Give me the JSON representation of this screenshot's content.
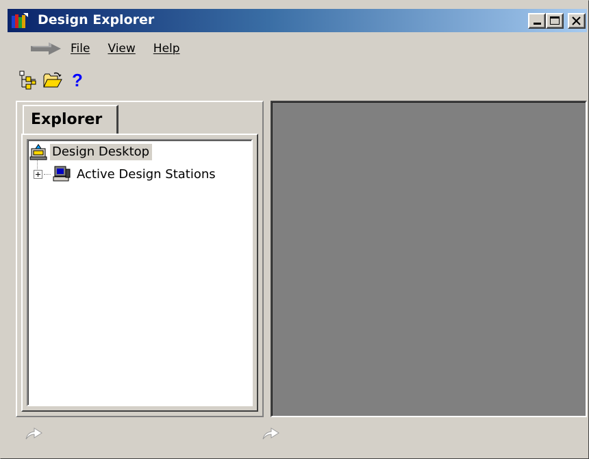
{
  "window": {
    "title": "Design Explorer",
    "icon": "design-explorer-app-icon",
    "title_gradient": [
      "#0a246a",
      "#a6caf0"
    ]
  },
  "caption_buttons": {
    "minimize": "minimize-icon",
    "maximize": "maximize-icon",
    "close": "close-icon"
  },
  "menu": {
    "back_icon": "back-arrow-icon",
    "items": [
      {
        "label": "File",
        "accel": "F"
      },
      {
        "label": "View",
        "accel": "V"
      },
      {
        "label": "Help",
        "accel": "H"
      }
    ]
  },
  "toolbar": {
    "buttons": [
      {
        "icon": "tree-view-icon"
      },
      {
        "icon": "open-folder-icon"
      },
      {
        "icon": "help-icon",
        "glyph": "?"
      }
    ]
  },
  "explorer": {
    "tab_label": "Explorer",
    "tree": {
      "root": {
        "label": "Design Desktop",
        "icon": "design-desktop-icon",
        "selected": true
      },
      "children": [
        {
          "label": "Active Design Stations",
          "icon": "workstation-icon",
          "expanded": false
        }
      ]
    }
  },
  "right_pane": {
    "background": "#808080"
  },
  "status": {
    "left_icon": "forward-arrow-icon",
    "right_icon": "forward-arrow-icon"
  }
}
